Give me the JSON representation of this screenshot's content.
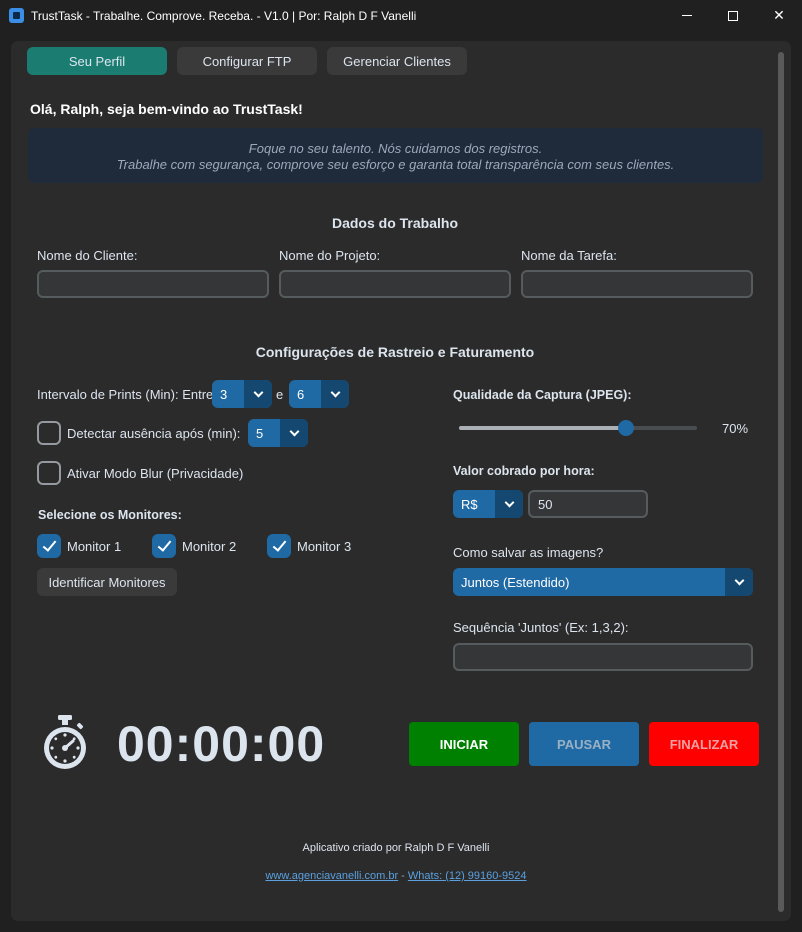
{
  "window": {
    "title": "TrustTask - Trabalhe. Comprove. Receba. - V1.0 | Por: Ralph D F Vanelli"
  },
  "tabs": [
    {
      "label": "Seu Perfil",
      "active": true
    },
    {
      "label": "Configurar FTP",
      "active": false
    },
    {
      "label": "Gerenciar Clientes",
      "active": false
    }
  ],
  "greeting": "Olá, Ralph, seja bem-vindo ao TrustTask!",
  "quote": {
    "line1": "Foque no seu talento. Nós cuidamos dos registros.",
    "line2": "Trabalhe com segurança, comprove seu esforço e garanta total transparência com seus clientes."
  },
  "work_data": {
    "title": "Dados do Trabalho",
    "client_label": "Nome do Cliente:",
    "client_value": "",
    "project_label": "Nome do Projeto:",
    "project_value": "",
    "task_label": "Nome da Tarefa:",
    "task_value": ""
  },
  "tracking": {
    "title": "Configurações de Rastreio e Faturamento",
    "interval_label": "Intervalo de Prints (Min): Entre",
    "interval_min": "3",
    "interval_and": "e",
    "interval_max": "6",
    "absence_label": "Detectar ausência após (min):",
    "absence_checked": false,
    "absence_value": "5",
    "blur_label": "Ativar Modo Blur (Privacidade)",
    "blur_checked": false,
    "monitors_label": "Selecione os Monitores:",
    "monitors": [
      {
        "label": "Monitor 1",
        "checked": true
      },
      {
        "label": "Monitor 2",
        "checked": true
      },
      {
        "label": "Monitor 3",
        "checked": true
      }
    ],
    "identify_button": "Identificar Monitores",
    "quality_label": "Qualidade da Captura (JPEG):",
    "quality_value": 70,
    "quality_text": "70%",
    "rate_label": "Valor cobrado por hora:",
    "currency": "R$",
    "rate_value": "50",
    "save_mode_label": "Como salvar as imagens?",
    "save_mode_value": "Juntos (Estendido)",
    "sequence_label": "Sequência 'Juntos' (Ex: 1,3,2):",
    "sequence_value": ""
  },
  "timer": {
    "display": "00:00:00"
  },
  "controls": {
    "start": "INICIAR",
    "pause": "PAUSAR",
    "finish": "FINALIZAR"
  },
  "colors": {
    "start": "#008000",
    "pause": "#1f6aa5",
    "finish": "#ff0000",
    "accent": "#1f6aa5",
    "active_tab": "#1b7d72"
  },
  "footer": {
    "credit": "Aplicativo criado por Ralph D F Vanelli",
    "site": "www.agenciavanelli.com.br",
    "separator": "-",
    "whats": "Whats: (12) 99160-9524"
  }
}
